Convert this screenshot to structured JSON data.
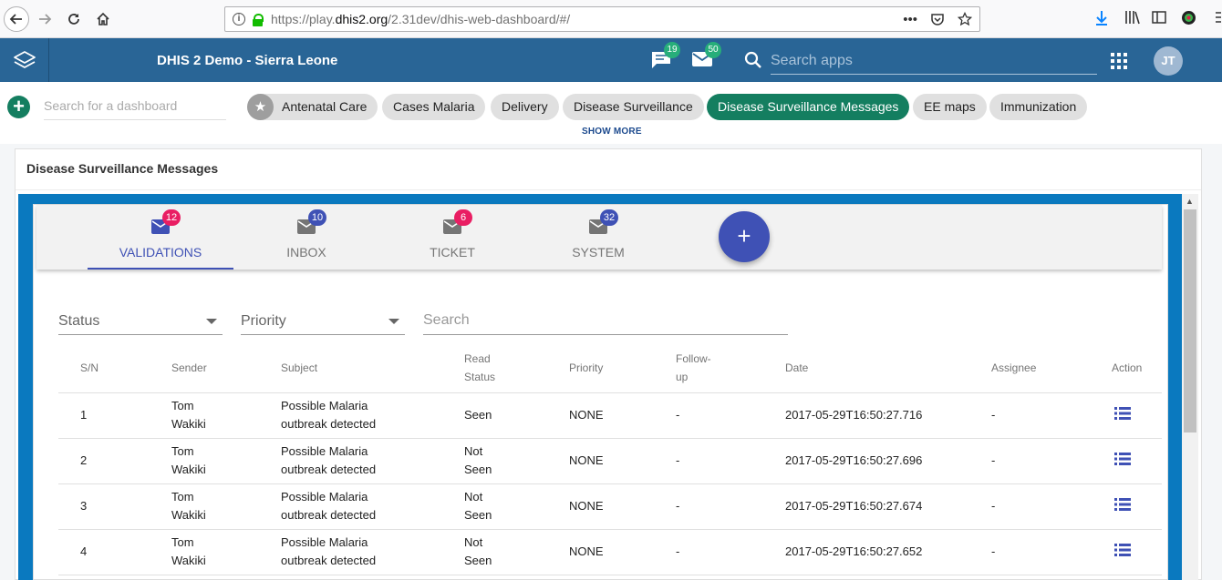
{
  "browser": {
    "url_prefix": "https://play.",
    "url_domain": "dhis2.org",
    "url_path": "/2.31dev/dhis-web-dashboard/#/",
    "more_label": "•••"
  },
  "header": {
    "title": "DHIS 2 Demo - Sierra Leone",
    "interpretations_count": "19",
    "messages_count": "50",
    "search_placeholder": "Search apps",
    "avatar_initials": "JT",
    "colors": {
      "bar": "#296596",
      "badge": "#27ae7a"
    }
  },
  "dashboards": {
    "search_placeholder": "Search for a dashboard",
    "chips": [
      {
        "label": "Antenatal Care",
        "starred": true
      },
      {
        "label": "Cases Malaria"
      },
      {
        "label": "Delivery"
      },
      {
        "label": "Disease Surveillance"
      },
      {
        "label": "Disease Surveillance Messages",
        "active": true
      },
      {
        "label": "EE maps"
      },
      {
        "label": "Immunization"
      }
    ],
    "show_more": "SHOW MORE",
    "active_color": "#147e60"
  },
  "item": {
    "title": "Disease Surveillance Messages"
  },
  "tabs": [
    {
      "label": "VALIDATIONS",
      "count": "12",
      "badge_color": "#e91e63",
      "active": true
    },
    {
      "label": "INBOX",
      "count": "10",
      "badge_color": "#3f51b5"
    },
    {
      "label": "TICKET",
      "count": "6",
      "badge_color": "#e91e63"
    },
    {
      "label": "SYSTEM",
      "count": "32",
      "badge_color": "#3f51b5"
    }
  ],
  "fab_label": "+",
  "filters": {
    "status": "Status",
    "priority": "Priority",
    "search_placeholder": "Search"
  },
  "table": {
    "headers": {
      "sn": "S/N",
      "sender": "Sender",
      "subject": "Subject",
      "read_status_1": "Read",
      "read_status_2": "Status",
      "priority": "Priority",
      "follow_up_1": "Follow-",
      "follow_up_2": "up",
      "date": "Date",
      "assignee": "Assignee",
      "action": "Action"
    },
    "rows": [
      {
        "sn": "1",
        "sender_1": "Tom",
        "sender_2": "Wakiki",
        "subject_1": "Possible Malaria",
        "subject_2": "outbreak detected",
        "read_1": "Seen",
        "read_2": "",
        "priority": "NONE",
        "follow_up": "-",
        "date": "2017-05-29T16:50:27.716",
        "assignee": "-"
      },
      {
        "sn": "2",
        "sender_1": "Tom",
        "sender_2": "Wakiki",
        "subject_1": "Possible Malaria",
        "subject_2": "outbreak detected",
        "read_1": "Not",
        "read_2": "Seen",
        "priority": "NONE",
        "follow_up": "-",
        "date": "2017-05-29T16:50:27.696",
        "assignee": "-"
      },
      {
        "sn": "3",
        "sender_1": "Tom",
        "sender_2": "Wakiki",
        "subject_1": "Possible Malaria",
        "subject_2": "outbreak detected",
        "read_1": "Not",
        "read_2": "Seen",
        "priority": "NONE",
        "follow_up": "-",
        "date": "2017-05-29T16:50:27.674",
        "assignee": "-"
      },
      {
        "sn": "4",
        "sender_1": "Tom",
        "sender_2": "Wakiki",
        "subject_1": "Possible Malaria",
        "subject_2": "outbreak detected",
        "read_1": "Not",
        "read_2": "Seen",
        "priority": "NONE",
        "follow_up": "-",
        "date": "2017-05-29T16:50:27.652",
        "assignee": "-"
      }
    ]
  }
}
